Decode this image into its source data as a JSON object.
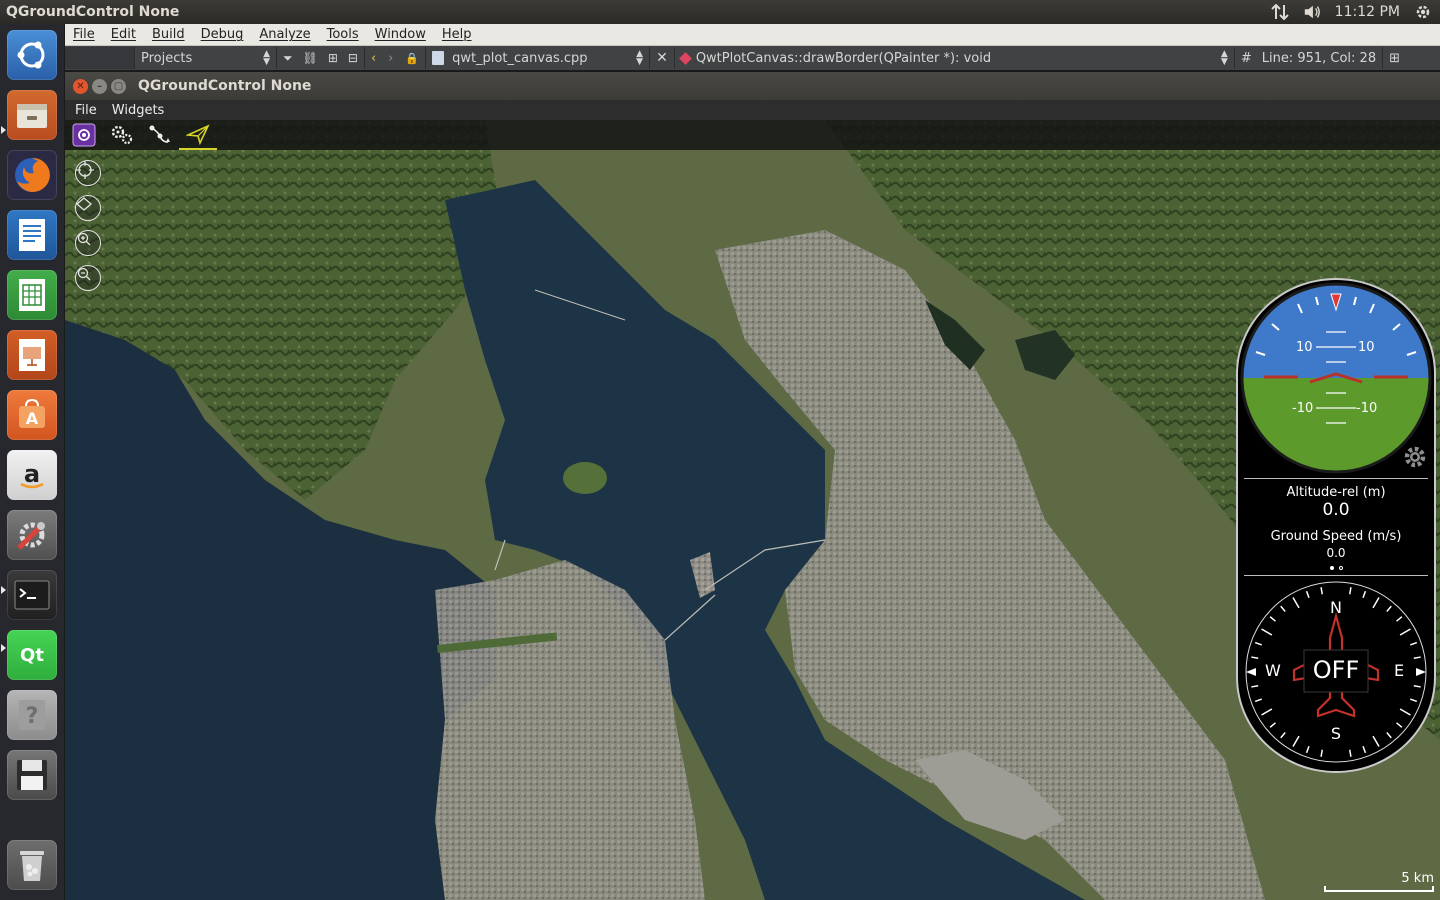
{
  "top_panel": {
    "title": "QGroundControl None",
    "clock": "11:12 PM",
    "icons": [
      "network-transfer-icon",
      "volume-icon",
      "system-gear-icon"
    ]
  },
  "launcher": {
    "items": [
      {
        "name": "ubuntu-dash-icon",
        "color": "#3a6fb5"
      },
      {
        "name": "files-icon",
        "color": "#c85a2b"
      },
      {
        "name": "firefox-icon",
        "color": "#e8602c"
      },
      {
        "name": "writer-icon",
        "color": "#2a6bb0"
      },
      {
        "name": "calc-icon",
        "color": "#3aa041"
      },
      {
        "name": "impress-icon",
        "color": "#c8531f"
      },
      {
        "name": "software-center-icon",
        "color": "#e2672f"
      },
      {
        "name": "amazon-icon",
        "color": "#d8d8d8"
      },
      {
        "name": "system-settings-icon",
        "color": "#6a6a6a"
      },
      {
        "name": "terminal-icon",
        "color": "#2d2d2d"
      },
      {
        "name": "qt-creator-icon",
        "color": "#41cd52"
      },
      {
        "name": "help-icon",
        "color": "#9a9a9a"
      },
      {
        "name": "save-disk-icon",
        "color": "#5a5a5a"
      },
      {
        "name": "trash-icon",
        "color": "#6a6a6a"
      }
    ]
  },
  "qtcreator": {
    "menu": [
      "File",
      "Edit",
      "Build",
      "Debug",
      "Analyze",
      "Tools",
      "Window",
      "Help"
    ],
    "projects_label": "Projects",
    "file_name": "qwt_plot_canvas.cpp",
    "function_name": "QwtPlotCanvas::drawBorder(QPainter *): void",
    "hash": "#",
    "position": "Line: 951, Col: 28"
  },
  "qgc": {
    "window_title": "QGroundControl None",
    "menu": [
      "File",
      "Widgets"
    ],
    "toolbar": [
      "qgc-logo-icon",
      "settings-gears-icon",
      "plan-route-icon",
      "fly-send-icon"
    ],
    "accent": "#d8d42a"
  },
  "instruments": {
    "pitch_labels": {
      "up_left": "10",
      "up_right": "10",
      "down_left": "-10",
      "down_right": "-10"
    },
    "altitude_label": "Altitude-rel (m)",
    "altitude_value": "0.0",
    "speed_label": "Ground Speed (m/s)",
    "speed_value": "0.0",
    "compass": {
      "n": "N",
      "s": "S",
      "e": "E",
      "w": "W",
      "status": "OFF"
    },
    "sky_color": "#3f79c9",
    "ground_color": "#5c9a2b"
  },
  "map": {
    "scale_label": "5 km"
  }
}
